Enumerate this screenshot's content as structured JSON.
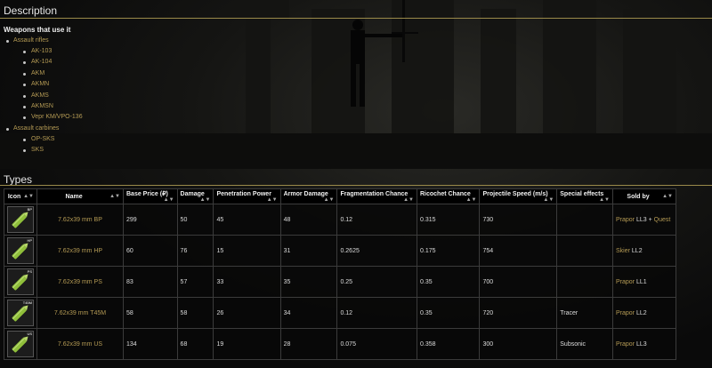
{
  "description": {
    "title": "Description",
    "weapons_heading": "Weapons that use it",
    "categories": [
      {
        "label": "Assault rifles",
        "items": [
          "AK-103",
          "AK-104",
          "AKM",
          "AKMN",
          "AKMS",
          "AKMSN",
          "Vepr KM/VPO-136"
        ]
      },
      {
        "label": "Assault carbines",
        "items": [
          "OP-SKS",
          "SKS"
        ]
      }
    ]
  },
  "types": {
    "title": "Types",
    "headers": [
      "Icon",
      "Name",
      "Base Price (₽)",
      "Damage",
      "Penetration Power",
      "Armor Damage",
      "Fragmentation Chance",
      "Ricochet Chance",
      "Projectile Speed (m/s)",
      "Special effects",
      "Sold by"
    ],
    "sort_glyph": "▲▼",
    "rows": [
      {
        "icon_tag": "BP",
        "name": "7.62x39 mm BP",
        "price": "299",
        "damage": "50",
        "pen": "45",
        "armor": "48",
        "frag": "0.12",
        "ricochet": "0.315",
        "speed": "730",
        "effects": "",
        "trader": "Prapor",
        "level": "LL3",
        "extra": "Quest"
      },
      {
        "icon_tag": "HP",
        "name": "7.62x39 mm HP",
        "price": "60",
        "damage": "76",
        "pen": "15",
        "armor": "31",
        "frag": "0.2625",
        "ricochet": "0.175",
        "speed": "754",
        "effects": "",
        "trader": "Skier",
        "level": "LL2",
        "extra": ""
      },
      {
        "icon_tag": "PS",
        "name": "7.62x39 mm PS",
        "price": "83",
        "damage": "57",
        "pen": "33",
        "armor": "35",
        "frag": "0.25",
        "ricochet": "0.35",
        "speed": "700",
        "effects": "",
        "trader": "Prapor",
        "level": "LL1",
        "extra": ""
      },
      {
        "icon_tag": "T45M",
        "name": "7.62x39 mm T45M",
        "price": "58",
        "damage": "58",
        "pen": "26",
        "armor": "34",
        "frag": "0.12",
        "ricochet": "0.35",
        "speed": "720",
        "effects": "Tracer",
        "trader": "Prapor",
        "level": "LL2",
        "extra": ""
      },
      {
        "icon_tag": "US",
        "name": "7.62x39 mm US",
        "price": "134",
        "damage": "68",
        "pen": "19",
        "armor": "28",
        "frag": "0.075",
        "ricochet": "0.358",
        "speed": "300",
        "effects": "Subsonic",
        "trader": "Prapor",
        "level": "LL3",
        "extra": ""
      }
    ]
  }
}
